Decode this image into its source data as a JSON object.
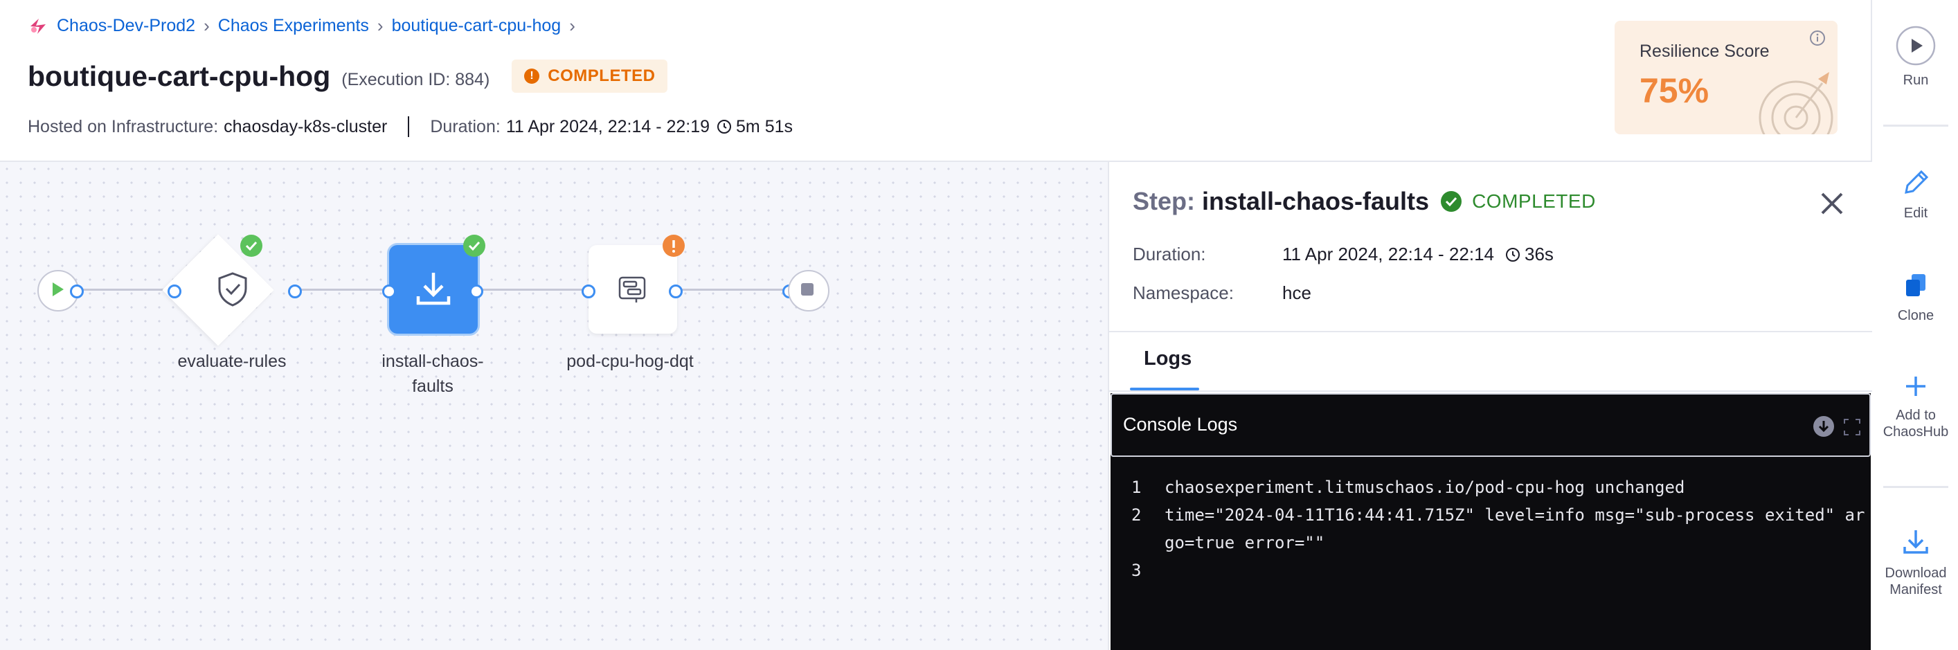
{
  "breadcrumb": {
    "project": "Chaos-Dev-Prod2",
    "section": "Chaos Experiments",
    "experiment": "boutique-cart-cpu-hog"
  },
  "header": {
    "title": "boutique-cart-cpu-hog",
    "execution_id": "(Execution ID: 884)",
    "status": "COMPLETED",
    "infra_label": "Hosted on Infrastructure:",
    "infra_value": "chaosday-k8s-cluster",
    "duration_label": "Duration:",
    "duration_value": "11 Apr 2024, 22:14 - 22:19",
    "duration_elapsed": "5m 51s"
  },
  "resilience": {
    "label": "Resilience Score",
    "value": "75%",
    "percent": 75
  },
  "actions": {
    "run": "Run",
    "edit": "Edit",
    "clone": "Clone",
    "add_hub_1": "Add to",
    "add_hub_2": "ChaosHub",
    "download_1": "Download",
    "download_2": "Manifest"
  },
  "pipeline": {
    "nodes": [
      {
        "label": "evaluate-rules",
        "status": "success",
        "icon": "shield-check-icon"
      },
      {
        "label_1": "install-chaos-",
        "label_2": "faults",
        "status": "success",
        "icon": "download-icon"
      },
      {
        "label": "pod-cpu-hog-dqt",
        "status": "warning",
        "icon": "fault-icon"
      }
    ]
  },
  "step": {
    "label": "Step:",
    "name": "install-chaos-faults",
    "status": "COMPLETED",
    "duration_label": "Duration:",
    "duration_value": "11 Apr 2024, 22:14 - 22:14",
    "duration_elapsed": "36s",
    "namespace_label": "Namespace:",
    "namespace_value": "hce"
  },
  "tabs": {
    "logs": "Logs"
  },
  "console": {
    "title": "Console Logs",
    "lines": [
      {
        "n": "1",
        "text": "chaosexperiment.litmuschaos.io/pod-cpu-hog unchanged"
      },
      {
        "n": "2",
        "text": "time=\"2024-04-11T16:44:41.715Z\" level=info msg=\"sub-process exited\" argo=true error=\"\""
      },
      {
        "n": "3",
        "text": ""
      }
    ]
  },
  "colors": {
    "accent": "#3d8ef2",
    "link": "#0b63d6",
    "warning": "#e66b00",
    "success": "#2e8b2e",
    "score": "#f0873c"
  }
}
